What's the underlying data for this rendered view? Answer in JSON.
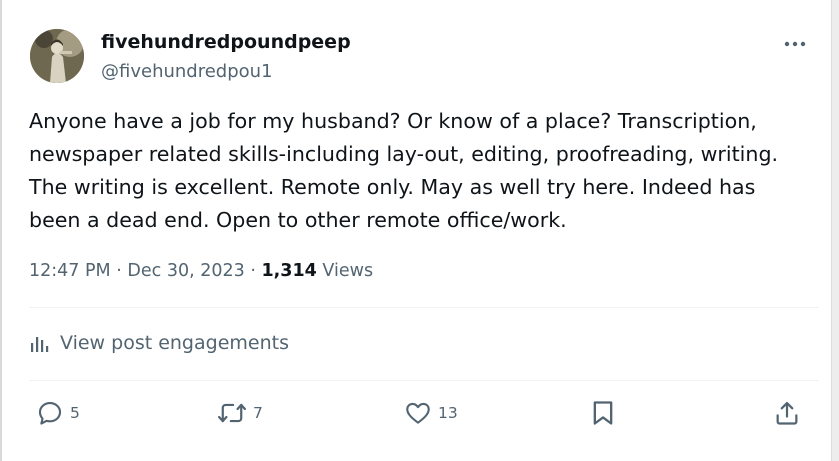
{
  "post": {
    "author": {
      "display_name": "fivehundredpoundpeep",
      "handle": "@fivehundredpou1"
    },
    "text_lines": [
      "Anyone have a job for my husband? Or know of a place? Transcription,",
      "newspaper related skills-including lay-out, editing, proofreading, writing.",
      "The writing is excellent. Remote only. May as well try here. Indeed has",
      "been a dead end. Open to other remote office/work."
    ],
    "time": "12:47 PM",
    "date": "Dec 30, 2023",
    "separator": "·",
    "views_count": "1,314",
    "views_label": "Views",
    "engagements_label": "View post engagements",
    "actions": {
      "replies": "5",
      "reposts": "7",
      "likes": "13"
    }
  },
  "colors": {
    "text_primary": "#0f1419",
    "text_secondary": "#536471",
    "divider": "#eff3f4"
  },
  "icons": {
    "more": "more-dots-icon",
    "engagements": "bar-chart-icon",
    "reply": "speech-bubble-icon",
    "repost": "repost-arrows-icon",
    "like": "heart-icon",
    "bookmark": "bookmark-icon",
    "share": "share-upload-icon"
  }
}
